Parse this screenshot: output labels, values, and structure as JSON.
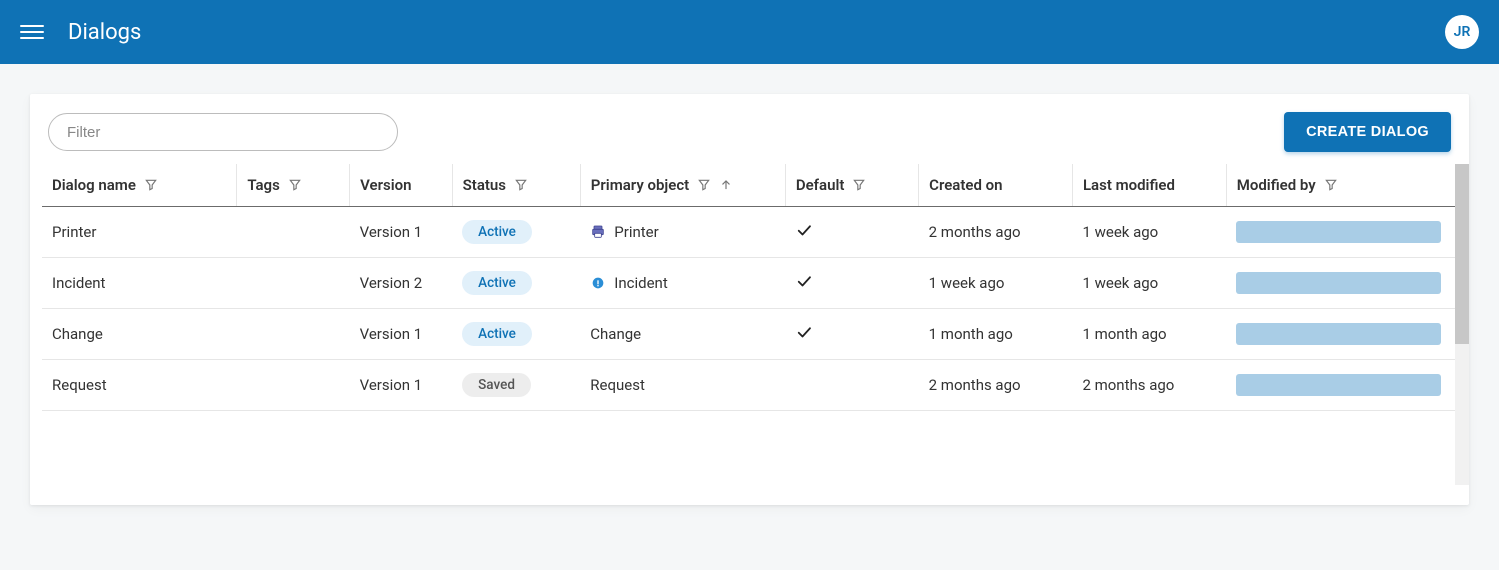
{
  "header": {
    "title": "Dialogs",
    "avatar_initials": "JR"
  },
  "toolbar": {
    "filter_placeholder": "Filter",
    "create_label": "CREATE DIALOG"
  },
  "columns": {
    "name": "Dialog name",
    "tags": "Tags",
    "version": "Version",
    "status": "Status",
    "primary_object": "Primary object",
    "default": "Default",
    "created_on": "Created on",
    "last_modified": "Last modified",
    "modified_by": "Modified by"
  },
  "status_labels": {
    "active": "Active",
    "saved": "Saved"
  },
  "rows": [
    {
      "name": "Printer",
      "tags": "",
      "version": "Version 1",
      "status": "active",
      "object": "Printer",
      "object_icon": "printer",
      "default": true,
      "created_on": "2 months ago",
      "last_modified": "1 week ago"
    },
    {
      "name": "Incident",
      "tags": "",
      "version": "Version 2",
      "status": "active",
      "object": "Incident",
      "object_icon": "incident",
      "default": true,
      "created_on": "1 week ago",
      "last_modified": "1 week ago"
    },
    {
      "name": "Change",
      "tags": "",
      "version": "Version 1",
      "status": "active",
      "object": "Change",
      "object_icon": "",
      "default": true,
      "created_on": "1 month ago",
      "last_modified": "1 month ago"
    },
    {
      "name": "Request",
      "tags": "",
      "version": "Version 1",
      "status": "saved",
      "object": "Request",
      "object_icon": "",
      "default": false,
      "created_on": "2 months ago",
      "last_modified": "2 months ago"
    }
  ]
}
